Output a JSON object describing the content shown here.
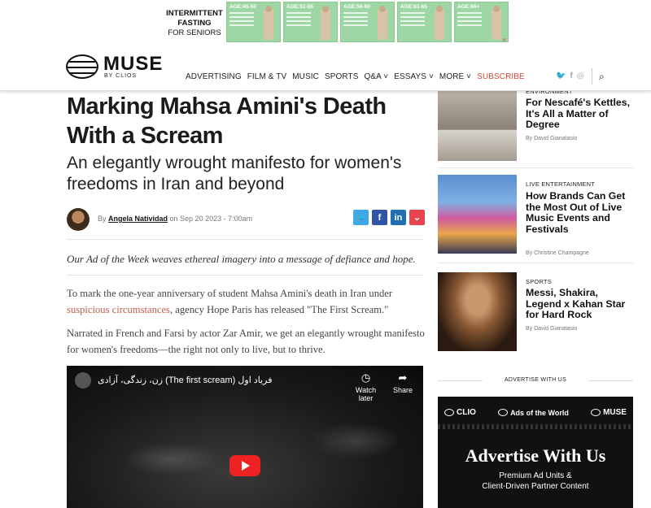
{
  "ad": {
    "line1": "INTERMITTENT",
    "line2": "FASTING",
    "line3": "FOR SENIORS",
    "tiles": [
      "AGE:45-50",
      "AGE:51-55",
      "AGE:56-60",
      "AGE:61-65",
      "AGE:66+"
    ],
    "close_icon": "adchoices-icon"
  },
  "header": {
    "logo_word": "MUSE",
    "logo_sub": "BY CLIOS",
    "nav": [
      "ADVERTISING",
      "FILM & TV",
      "MUSIC",
      "SPORTS",
      "Q&A ˅",
      "ESSAYS ˅",
      "MORE ˅"
    ],
    "subscribe": "SUBSCRIBE",
    "social": [
      "twitter-icon",
      "facebook-icon",
      "instagram-icon"
    ],
    "search_icon": "search-icon"
  },
  "article": {
    "title": "Marking Mahsa Amini's Death With a Scream",
    "subtitle": "An elegantly wrought manifesto for women's freedoms in Iran and beyond",
    "by_prefix": "By ",
    "author": "Angela Natividad",
    "date": " on Sep 20 2023 - 7:00am",
    "share": [
      "twitter",
      "facebook",
      "linkedin",
      "pocket"
    ],
    "lede": "Our Ad of the Week weaves ethereal imagery into a message of defiance and hope.",
    "p1_a": "To mark the one-year anniversary of student Mahsa Amini's death in Iran under ",
    "p1_link": "suspicious circumstances",
    "p1_b": ", agency Hope Paris has released \"The First Scream.\"",
    "p2": "Narrated in French and Farsi by actor Zar Amir, we get an elegantly wrought manifesto for women's freedoms—the right not only to live, but to thrive.",
    "video": {
      "title": "زن، زندگی، آزادی (The first scream) فریاد اول",
      "watch_later": "Watch later",
      "share": "Share"
    }
  },
  "sidebar": {
    "cards": [
      {
        "category": "ENVIRONMENT",
        "headline": "For Nescafé's Kettles, It's All a Matter of Degree",
        "byline": "By David Gianatasio"
      },
      {
        "category": "LIVE ENTERTAINMENT",
        "headline": "How Brands Can Get the Most Out of Live Music Events and Festivals",
        "byline": "By Christine Champagne"
      },
      {
        "category": "SPORTS",
        "headline": "Messi, Shakira, Legend x Kahan Star for Hard Rock",
        "byline": "By David Gianatasio"
      }
    ],
    "advertise_label": "ADVERTISE WITH US",
    "adv_logos": [
      "CLIO",
      "Ads of the World",
      "MUSE"
    ],
    "adv_head": "Advertise With Us",
    "adv_sub1": "Premium Ad Units &",
    "adv_sub2": "Client-Driven Partner Content"
  }
}
